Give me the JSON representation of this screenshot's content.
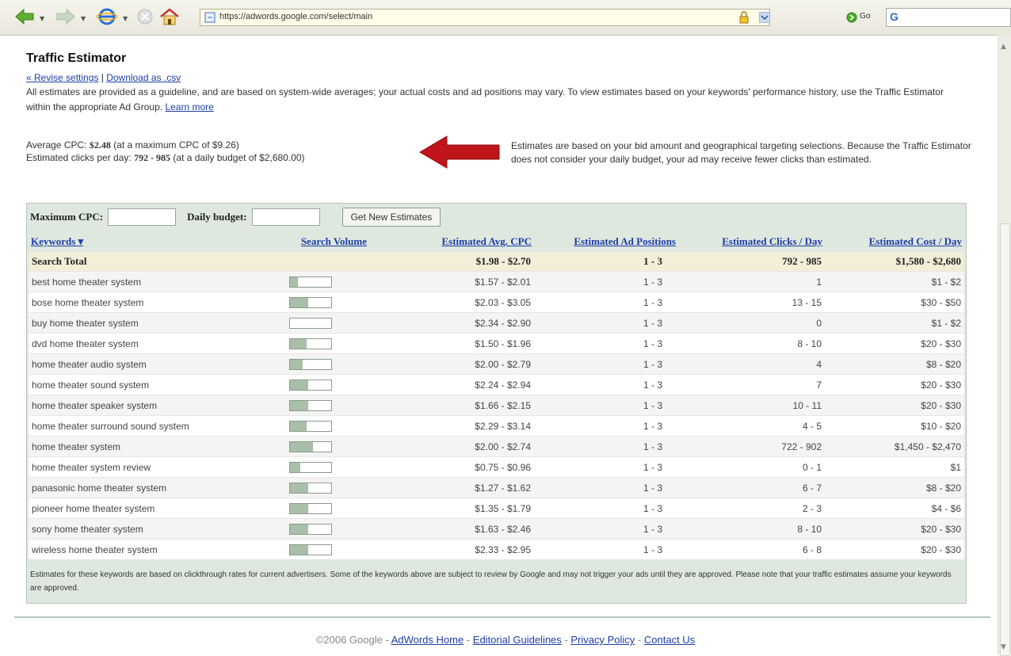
{
  "browser": {
    "url": "https://adwords.google.com/select/main",
    "go_label": "Go",
    "search_label": "G"
  },
  "page": {
    "title": "Traffic Estimator",
    "revise_link": "« Revise settings",
    "link_sep": " | ",
    "download_link": "Download as .csv",
    "disclaimer": "All estimates are provided as a guideline, and are based on system-wide averages; your actual costs and ad positions may vary. To view estimates based on your keywords' performance history, use the Traffic Estimator within the appropriate Ad Group.",
    "learn_more": "Learn more",
    "avg_cpc_label": "Average CPC: ",
    "avg_cpc_value": "$2.48",
    "avg_cpc_note": " (at a maximum CPC of $9.26)",
    "clicks_label": "Estimated clicks per day: ",
    "clicks_value": "792 - 985",
    "clicks_note": " (at a daily budget of $2,680.00)",
    "side_note": "Estimates are based on your bid amount and geographical targeting selections. Because the Traffic Estimator does not consider your daily budget, your ad may receive fewer clicks than estimated."
  },
  "controls": {
    "max_cpc_label": "Maximum CPC:",
    "daily_budget_label": "Daily budget:",
    "button_label": "Get New Estimates"
  },
  "table": {
    "headers": {
      "keywords": "Keywords ▾",
      "volume": "Search Volume",
      "cpc": "Estimated Avg. CPC",
      "position": "Estimated Ad Positions",
      "clicks": "Estimated Clicks / Day",
      "cost": "Estimated Cost / Day"
    },
    "total": {
      "label": "Search Total",
      "cpc": "$1.98 - $2.70",
      "position": "1 - 3",
      "clicks": "792 - 985",
      "cost": "$1,580 - $2,680"
    },
    "rows": [
      {
        "keyword": "best home theater system",
        "volume": 0.2,
        "cpc": "$1.57 - $2.01",
        "position": "1 - 3",
        "clicks": "1",
        "cost": "$1 - $2"
      },
      {
        "keyword": "bose home theater system",
        "volume": 0.45,
        "cpc": "$2.03 - $3.05",
        "position": "1 - 3",
        "clicks": "13 - 15",
        "cost": "$30 - $50"
      },
      {
        "keyword": "buy home theater system",
        "volume": 0.0,
        "cpc": "$2.34 - $2.90",
        "position": "1 - 3",
        "clicks": "0",
        "cost": "$1 - $2"
      },
      {
        "keyword": "dvd home theater system",
        "volume": 0.4,
        "cpc": "$1.50 - $1.96",
        "position": "1 - 3",
        "clicks": "8 - 10",
        "cost": "$20 - $30"
      },
      {
        "keyword": "home theater audio system",
        "volume": 0.3,
        "cpc": "$2.00 - $2.79",
        "position": "1 - 3",
        "clicks": "4",
        "cost": "$8 - $20"
      },
      {
        "keyword": "home theater sound system",
        "volume": 0.45,
        "cpc": "$2.24 - $2.94",
        "position": "1 - 3",
        "clicks": "7",
        "cost": "$20 - $30"
      },
      {
        "keyword": "home theater speaker system",
        "volume": 0.45,
        "cpc": "$1.66 - $2.15",
        "position": "1 - 3",
        "clicks": "10 - 11",
        "cost": "$20 - $30"
      },
      {
        "keyword": "home theater surround sound system",
        "volume": 0.4,
        "cpc": "$2.29 - $3.14",
        "position": "1 - 3",
        "clicks": "4 - 5",
        "cost": "$10 - $20"
      },
      {
        "keyword": "home theater system",
        "volume": 0.55,
        "cpc": "$2.00 - $2.74",
        "position": "1 - 3",
        "clicks": "722 - 902",
        "cost": "$1,450 - $2,470"
      },
      {
        "keyword": "home theater system review",
        "volume": 0.25,
        "cpc": "$0.75 - $0.96",
        "position": "1 - 3",
        "clicks": "0 - 1",
        "cost": "$1"
      },
      {
        "keyword": "panasonic home theater system",
        "volume": 0.45,
        "cpc": "$1.27 - $1.62",
        "position": "1 - 3",
        "clicks": "6 - 7",
        "cost": "$8 - $20"
      },
      {
        "keyword": "pioneer home theater system",
        "volume": 0.45,
        "cpc": "$1.35 - $1.79",
        "position": "1 - 3",
        "clicks": "2 - 3",
        "cost": "$4 - $6"
      },
      {
        "keyword": "sony home theater system",
        "volume": 0.45,
        "cpc": "$1.63 - $2.46",
        "position": "1 - 3",
        "clicks": "8 - 10",
        "cost": "$20 - $30"
      },
      {
        "keyword": "wireless home theater system",
        "volume": 0.45,
        "cpc": "$2.33 - $2.95",
        "position": "1 - 3",
        "clicks": "6 - 8",
        "cost": "$20 - $30"
      }
    ]
  },
  "footnote": "Estimates for these keywords are based on clickthrough rates for current advertisers. Some of the keywords above are subject to review by Google and may not trigger your ads until they are approved. Please note that your traffic estimates assume your keywords are approved.",
  "footer": {
    "copyright": "©2006 Google - ",
    "links": [
      "AdWords Home",
      "Editorial Guidelines",
      "Privacy Policy",
      "Contact Us"
    ],
    "sep": " - "
  },
  "colors": {
    "link": "#1d3ea8",
    "panel": "#dfe8df",
    "total_row": "#f3eed8",
    "arrow": "#c0151b"
  }
}
